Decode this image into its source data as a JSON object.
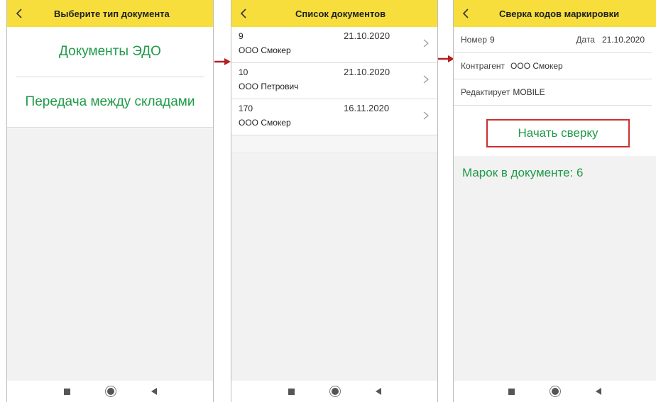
{
  "screen1": {
    "title": "Выберите тип документа",
    "items": [
      {
        "label": "Документы ЭДО"
      },
      {
        "label": "Передача между складами"
      }
    ]
  },
  "screen2": {
    "title": "Список документов",
    "documents": [
      {
        "number": "9",
        "counterparty": "ООО Смокер",
        "date": "21.10.2020"
      },
      {
        "number": "10",
        "counterparty": "ООО Петрович",
        "date": "21.10.2020"
      },
      {
        "number": "170",
        "counterparty": "ООО Смокер",
        "date": "16.11.2020"
      }
    ]
  },
  "screen3": {
    "title": "Сверка кодов маркировки",
    "number_label": "Номер",
    "number_value": "9",
    "date_label": "Дата",
    "date_value": "21.10.2020",
    "counterparty_label": "Контрагент",
    "counterparty_value": "ООО Смокер",
    "editor_label": "Редактирует",
    "editor_value": "MOBILE",
    "start_button": "Начать сверку",
    "marks_text": "Марок в документе: 6"
  },
  "colors": {
    "header": "#f7de3c",
    "accent_green": "#1f9a49",
    "highlight_red": "#cc3030",
    "arrow_red": "#b51f1f"
  },
  "icons": [
    "back-chevron-icon",
    "row-chevron-icon",
    "nav-square-icon",
    "nav-home-icon",
    "nav-back-icon",
    "transition-arrow-icon"
  ]
}
